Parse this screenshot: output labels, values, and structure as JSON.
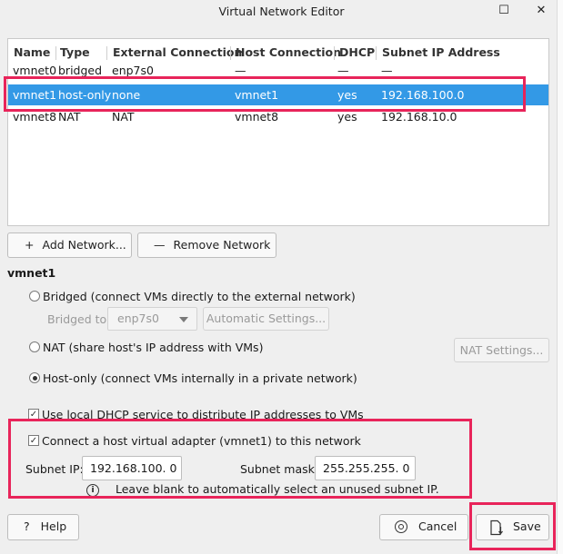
{
  "window": {
    "title": "Virtual Network Editor",
    "maximize_glyph": "☐",
    "close_glyph": "✕"
  },
  "table": {
    "headers": [
      "Name",
      "Type",
      "External Connection",
      "Host Connection",
      "DHCP",
      "Subnet IP Address"
    ],
    "rows": [
      [
        "vmnet0",
        "bridged",
        "enp7s0",
        "—",
        "—",
        "—"
      ],
      [
        "vmnet1",
        "host-only",
        "none",
        "vmnet1",
        "yes",
        "192.168.100.0"
      ],
      [
        "vmnet8",
        "NAT",
        "NAT",
        "vmnet8",
        "yes",
        "192.168.10.0"
      ]
    ],
    "selected_row": "vmnet1"
  },
  "buttons": {
    "add_network": "Add Network...",
    "add_icon": "+",
    "remove_network": "Remove Network",
    "remove_icon": "—",
    "automatic_settings": "Automatic Settings...",
    "nat_settings": "NAT Settings...",
    "help": "Help",
    "help_icon": "?",
    "cancel": "Cancel",
    "save": "Save"
  },
  "section": {
    "title": "vmnet1",
    "bridged": "Bridged (connect VMs directly to the external network)",
    "bridged_to_label": "Bridged to:",
    "bridged_to_value": "enp7s0",
    "nat": "NAT (share host's IP address with VMs)",
    "host_only": "Host-only (connect VMs internally in a private network)",
    "selected_mode": "host-only",
    "use_dhcp": "Use local DHCP service to distribute IP addresses to VMs",
    "use_dhcp_checked": true,
    "connect_adapter": "Connect a host virtual adapter (vmnet1) to this network",
    "connect_adapter_checked": true,
    "subnet_ip_label": "Subnet IP:",
    "subnet_ip_value": "192.168.100.  0",
    "subnet_mask_label": "Subnet mask:",
    "subnet_mask_value": "255.255.255.  0",
    "hint_icon": "i",
    "hint": "Leave blank to automatically select an unused subnet IP.",
    "check_glyph": "✓"
  },
  "colors": {
    "selection": "#3399e6",
    "highlight": "#e8245a"
  }
}
